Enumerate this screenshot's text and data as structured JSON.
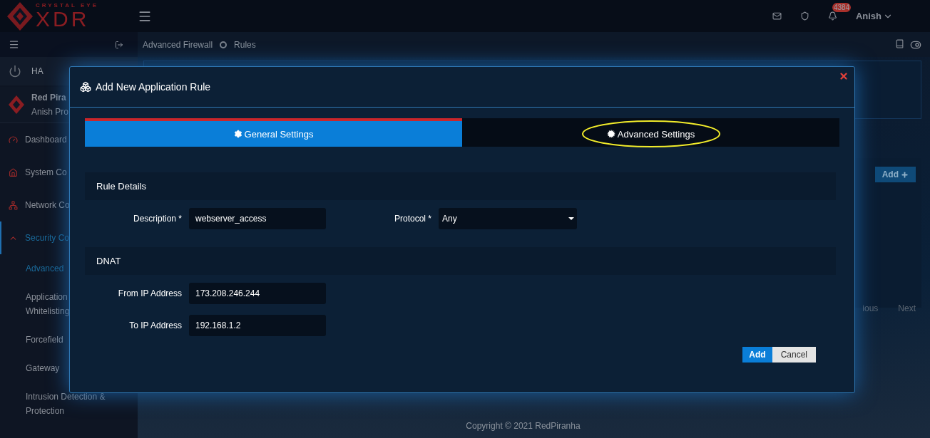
{
  "topbar": {
    "logo_top": "CRYSTAL EYE",
    "logo_main": "XDR",
    "notification_count": "4384",
    "user": "Anish"
  },
  "sidebar": {
    "ha": "HA",
    "org_name": "Red Pira",
    "org_profile": "Anish Pro",
    "items": [
      {
        "label": "Dashboard",
        "selected": false
      },
      {
        "label": "System Co",
        "selected": false
      },
      {
        "label": "Network Co",
        "selected": false
      },
      {
        "label": "Security Co",
        "selected": true,
        "children": [
          {
            "label": "Advanced",
            "selected": true
          },
          {
            "label": "Application Whitelisting",
            "selected": false
          },
          {
            "label": "Forcefield",
            "selected": false
          },
          {
            "label": "Gateway",
            "selected": false
          },
          {
            "label": "Intrusion Detection & Protection",
            "selected": false
          }
        ]
      }
    ]
  },
  "breadcrumb": [
    "Advanced Firewall",
    "Rules"
  ],
  "background": {
    "add_button": "Add",
    "pager_previous": "ious",
    "pager_next": "Next",
    "footer": "Copyright © 2021 RedPiranha"
  },
  "modal": {
    "title": "Add New Application Rule",
    "tabs": [
      {
        "label": "General Settings",
        "selected": true,
        "highlighted": false
      },
      {
        "label": "Advanced Settings",
        "selected": false,
        "highlighted": true
      }
    ],
    "sections": [
      {
        "title": "Rule Details",
        "kind": "inline",
        "fields": [
          {
            "label": "Description *",
            "value": "webserver_access",
            "kind": "text"
          },
          {
            "label": "Protocol *",
            "value": "Any",
            "kind": "select"
          }
        ]
      },
      {
        "title": "DNAT",
        "kind": "stacked",
        "fields": [
          {
            "label": "From IP Address",
            "value": "173.208.246.244",
            "kind": "text"
          },
          {
            "label": "To IP Address",
            "value": "192.168.1.2",
            "kind": "text"
          }
        ]
      }
    ],
    "buttons": [
      {
        "label": "Add",
        "kind": "primary"
      },
      {
        "label": "Cancel",
        "kind": "secondary"
      }
    ]
  }
}
